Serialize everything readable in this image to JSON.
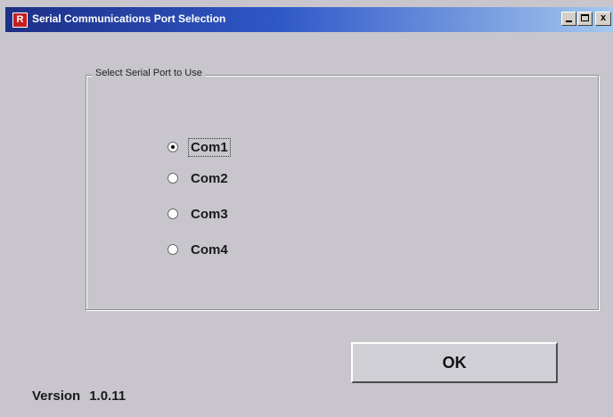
{
  "window": {
    "title": "Serial Communications Port Selection",
    "icon_text": "R",
    "controls": {
      "minimize": "minimize",
      "maximize": "maximize",
      "close": "x"
    }
  },
  "group": {
    "label": "Select Serial Port to Use",
    "options": [
      {
        "label": "Com1",
        "selected": true
      },
      {
        "label": "Com2",
        "selected": false
      },
      {
        "label": "Com3",
        "selected": false
      },
      {
        "label": "Com4",
        "selected": false
      }
    ]
  },
  "ok_button": {
    "label": "OK"
  },
  "version": {
    "label": "Version",
    "value": "1.0.11"
  },
  "colors": {
    "background": "#c8c6cc",
    "titlebar_start": "#1d2f86",
    "titlebar_end": "#a4c8ee",
    "app_icon": "#c41e1e"
  }
}
